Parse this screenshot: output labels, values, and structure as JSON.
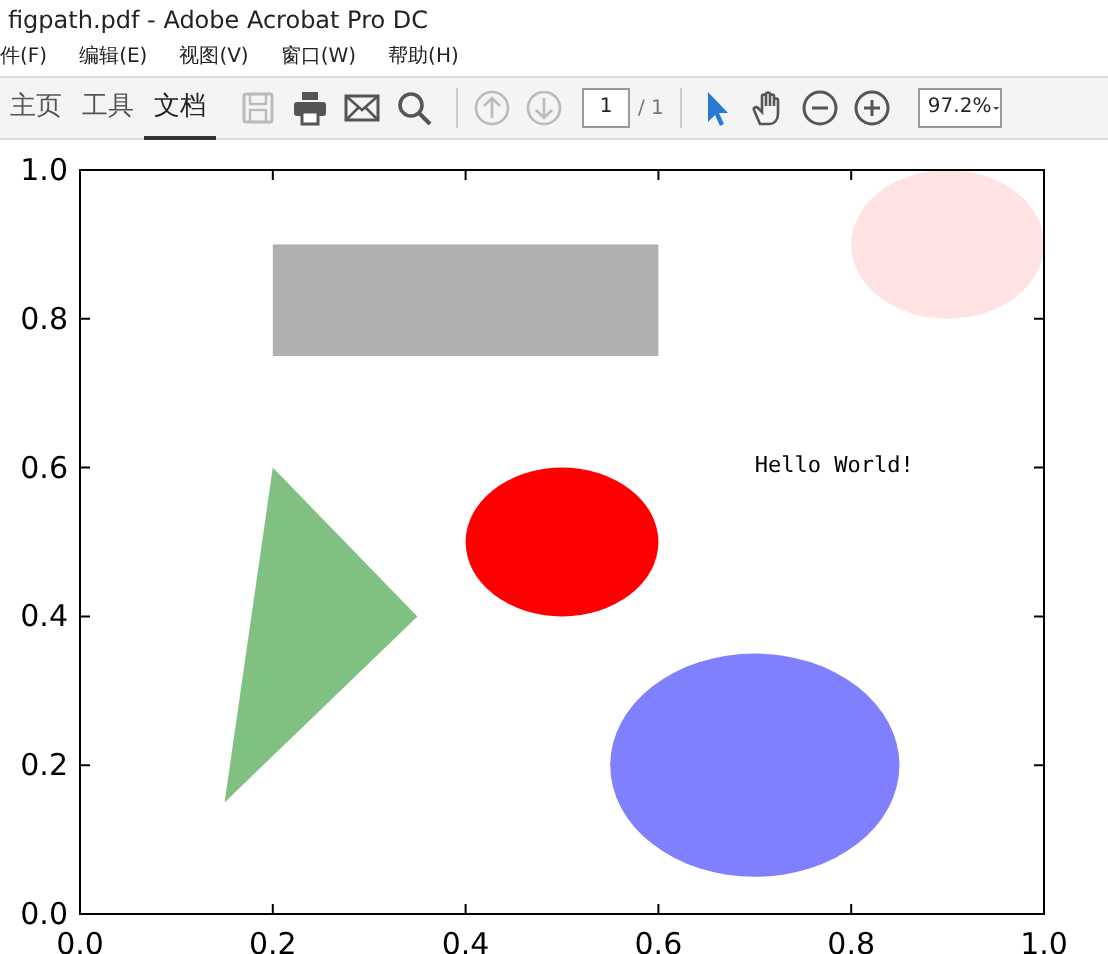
{
  "window": {
    "title": "figpath.pdf - Adobe Acrobat Pro DC"
  },
  "menu": [
    "件(F)",
    "编辑(E)",
    "视图(V)",
    "窗口(W)",
    "帮助(H)"
  ],
  "tabs": [
    {
      "label": "主页",
      "selected": false
    },
    {
      "label": "工具",
      "selected": false
    },
    {
      "label": "文档",
      "selected": true
    }
  ],
  "toolbar": {
    "tools": [
      {
        "kind": "save",
        "disabled": true
      },
      {
        "kind": "print",
        "disabled": false
      },
      {
        "kind": "mail",
        "disabled": false
      },
      {
        "kind": "search",
        "disabled": false
      },
      {
        "kind": "sep"
      },
      {
        "kind": "up",
        "disabled": true
      },
      {
        "kind": "down",
        "disabled": true
      }
    ],
    "page": "1",
    "page_total": "/ 1",
    "tools2": [
      {
        "kind": "pointer",
        "selected": true
      },
      {
        "kind": "hand",
        "selected": false
      },
      {
        "kind": "zoomout",
        "selected": false
      },
      {
        "kind": "zoomin",
        "selected": false
      }
    ],
    "zoom": "97.2%"
  },
  "document": {
    "chart_data": {
      "type": "scatter",
      "xlim": [
        0,
        1
      ],
      "ylim": [
        0,
        1
      ],
      "xticks": [
        {
          "value": 0,
          "label": "0.0"
        },
        {
          "value": 0.2,
          "label": "0.2"
        },
        {
          "value": 0.4,
          "label": "0.4"
        },
        {
          "value": 0.6,
          "label": "0.6"
        },
        {
          "value": 0.8,
          "label": "0.8"
        },
        {
          "value": 1,
          "label": "1.0"
        }
      ],
      "yticks": [
        {
          "value": 0,
          "label": "0.0"
        },
        {
          "value": 0.2,
          "label": "0.2"
        },
        {
          "value": 0.4,
          "label": "0.4"
        },
        {
          "value": 0.6,
          "label": "0.6"
        },
        {
          "value": 0.8,
          "label": "0.8"
        },
        {
          "value": 1,
          "label": "1.0"
        }
      ],
      "annotations": [
        "Hello World!"
      ]
    },
    "shapes": [
      {
        "kind": "rect",
        "color": "#b0b0b0"
      },
      {
        "kind": "ellipse",
        "color": "#ffe2e2"
      },
      {
        "kind": "polygon",
        "color": "#80c080"
      },
      {
        "kind": "ellipse",
        "color": "#ff0000"
      },
      {
        "kind": "ellipse",
        "color": "#8080ff"
      }
    ]
  }
}
